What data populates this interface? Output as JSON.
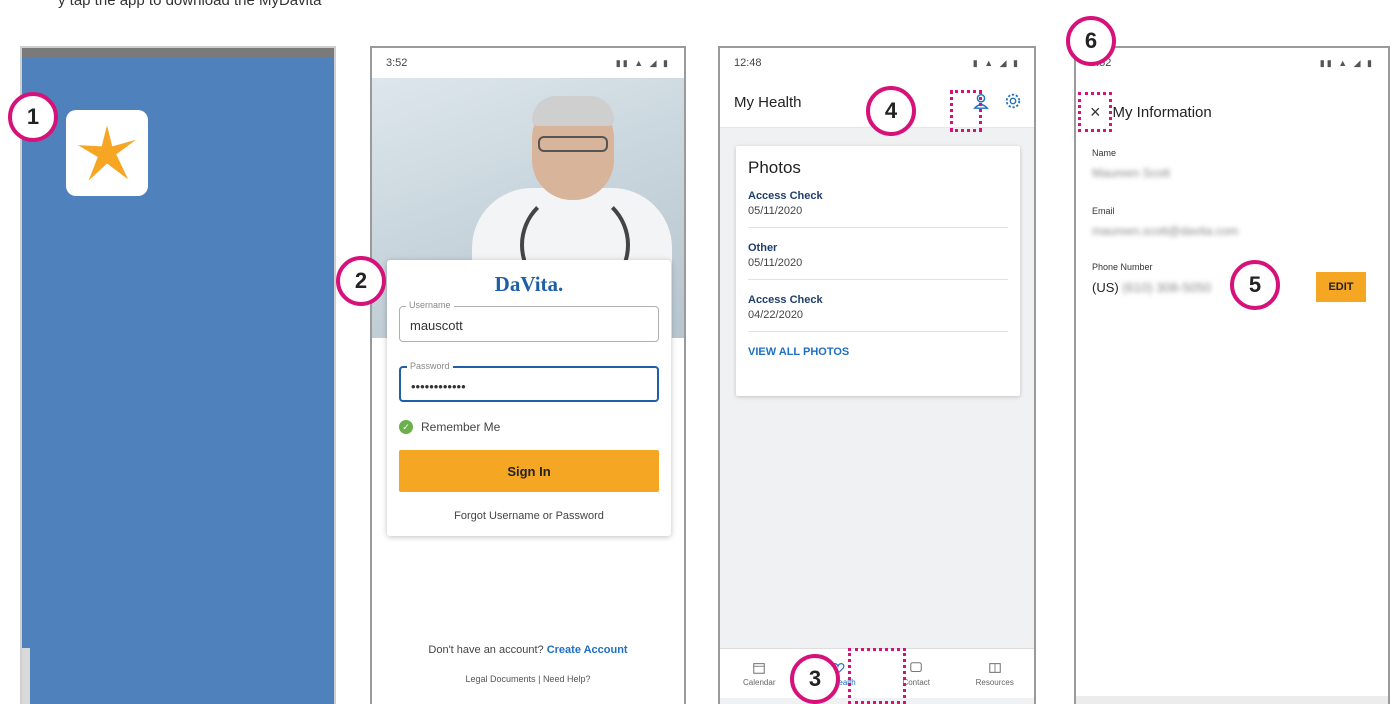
{
  "heading": "y tap the app to download the MyDavita",
  "colors": {
    "accent": "#d6127a",
    "brand": "#1f5fa8",
    "button": "#f5a623",
    "splash": "#4f81bd"
  },
  "callouts": [
    "1",
    "2",
    "3",
    "4",
    "5",
    "6"
  ],
  "splash": {
    "icon": "star-logo-icon"
  },
  "login": {
    "status_time": "3:52",
    "brand": "DaVita.",
    "username_label": "Username",
    "username_value": "mauscott",
    "password_label": "Password",
    "password_value": "••••••••••••",
    "remember": "Remember Me",
    "signin": "Sign In",
    "forgot": "Forgot Username or Password",
    "create_prefix": "Don't have an account?",
    "create_link": "Create Account",
    "legal": "Legal Documents",
    "sep": "|",
    "help": "Need Help?"
  },
  "health": {
    "status_time": "12:48",
    "title": "My Health",
    "card_title": "Photos",
    "photos": [
      {
        "type": "Access Check",
        "date": "05/11/2020"
      },
      {
        "type": "Other",
        "date": "05/11/2020"
      },
      {
        "type": "Access Check",
        "date": "04/22/2020"
      }
    ],
    "view_all": "VIEW ALL PHOTOS",
    "tabs": [
      "Calendar",
      "My Health",
      "Contact",
      "Resources"
    ]
  },
  "info": {
    "status_time": "3:52",
    "close": "×",
    "title": "My Information",
    "name_label": "Name",
    "name_value": "Maureen Scott",
    "email_label": "Email",
    "email_value": "maureen.scott@davita.com",
    "phone_label": "Phone Number",
    "phone_prefix": "(US)",
    "phone_value": "(610) 308-5050",
    "edit": "EDIT"
  }
}
